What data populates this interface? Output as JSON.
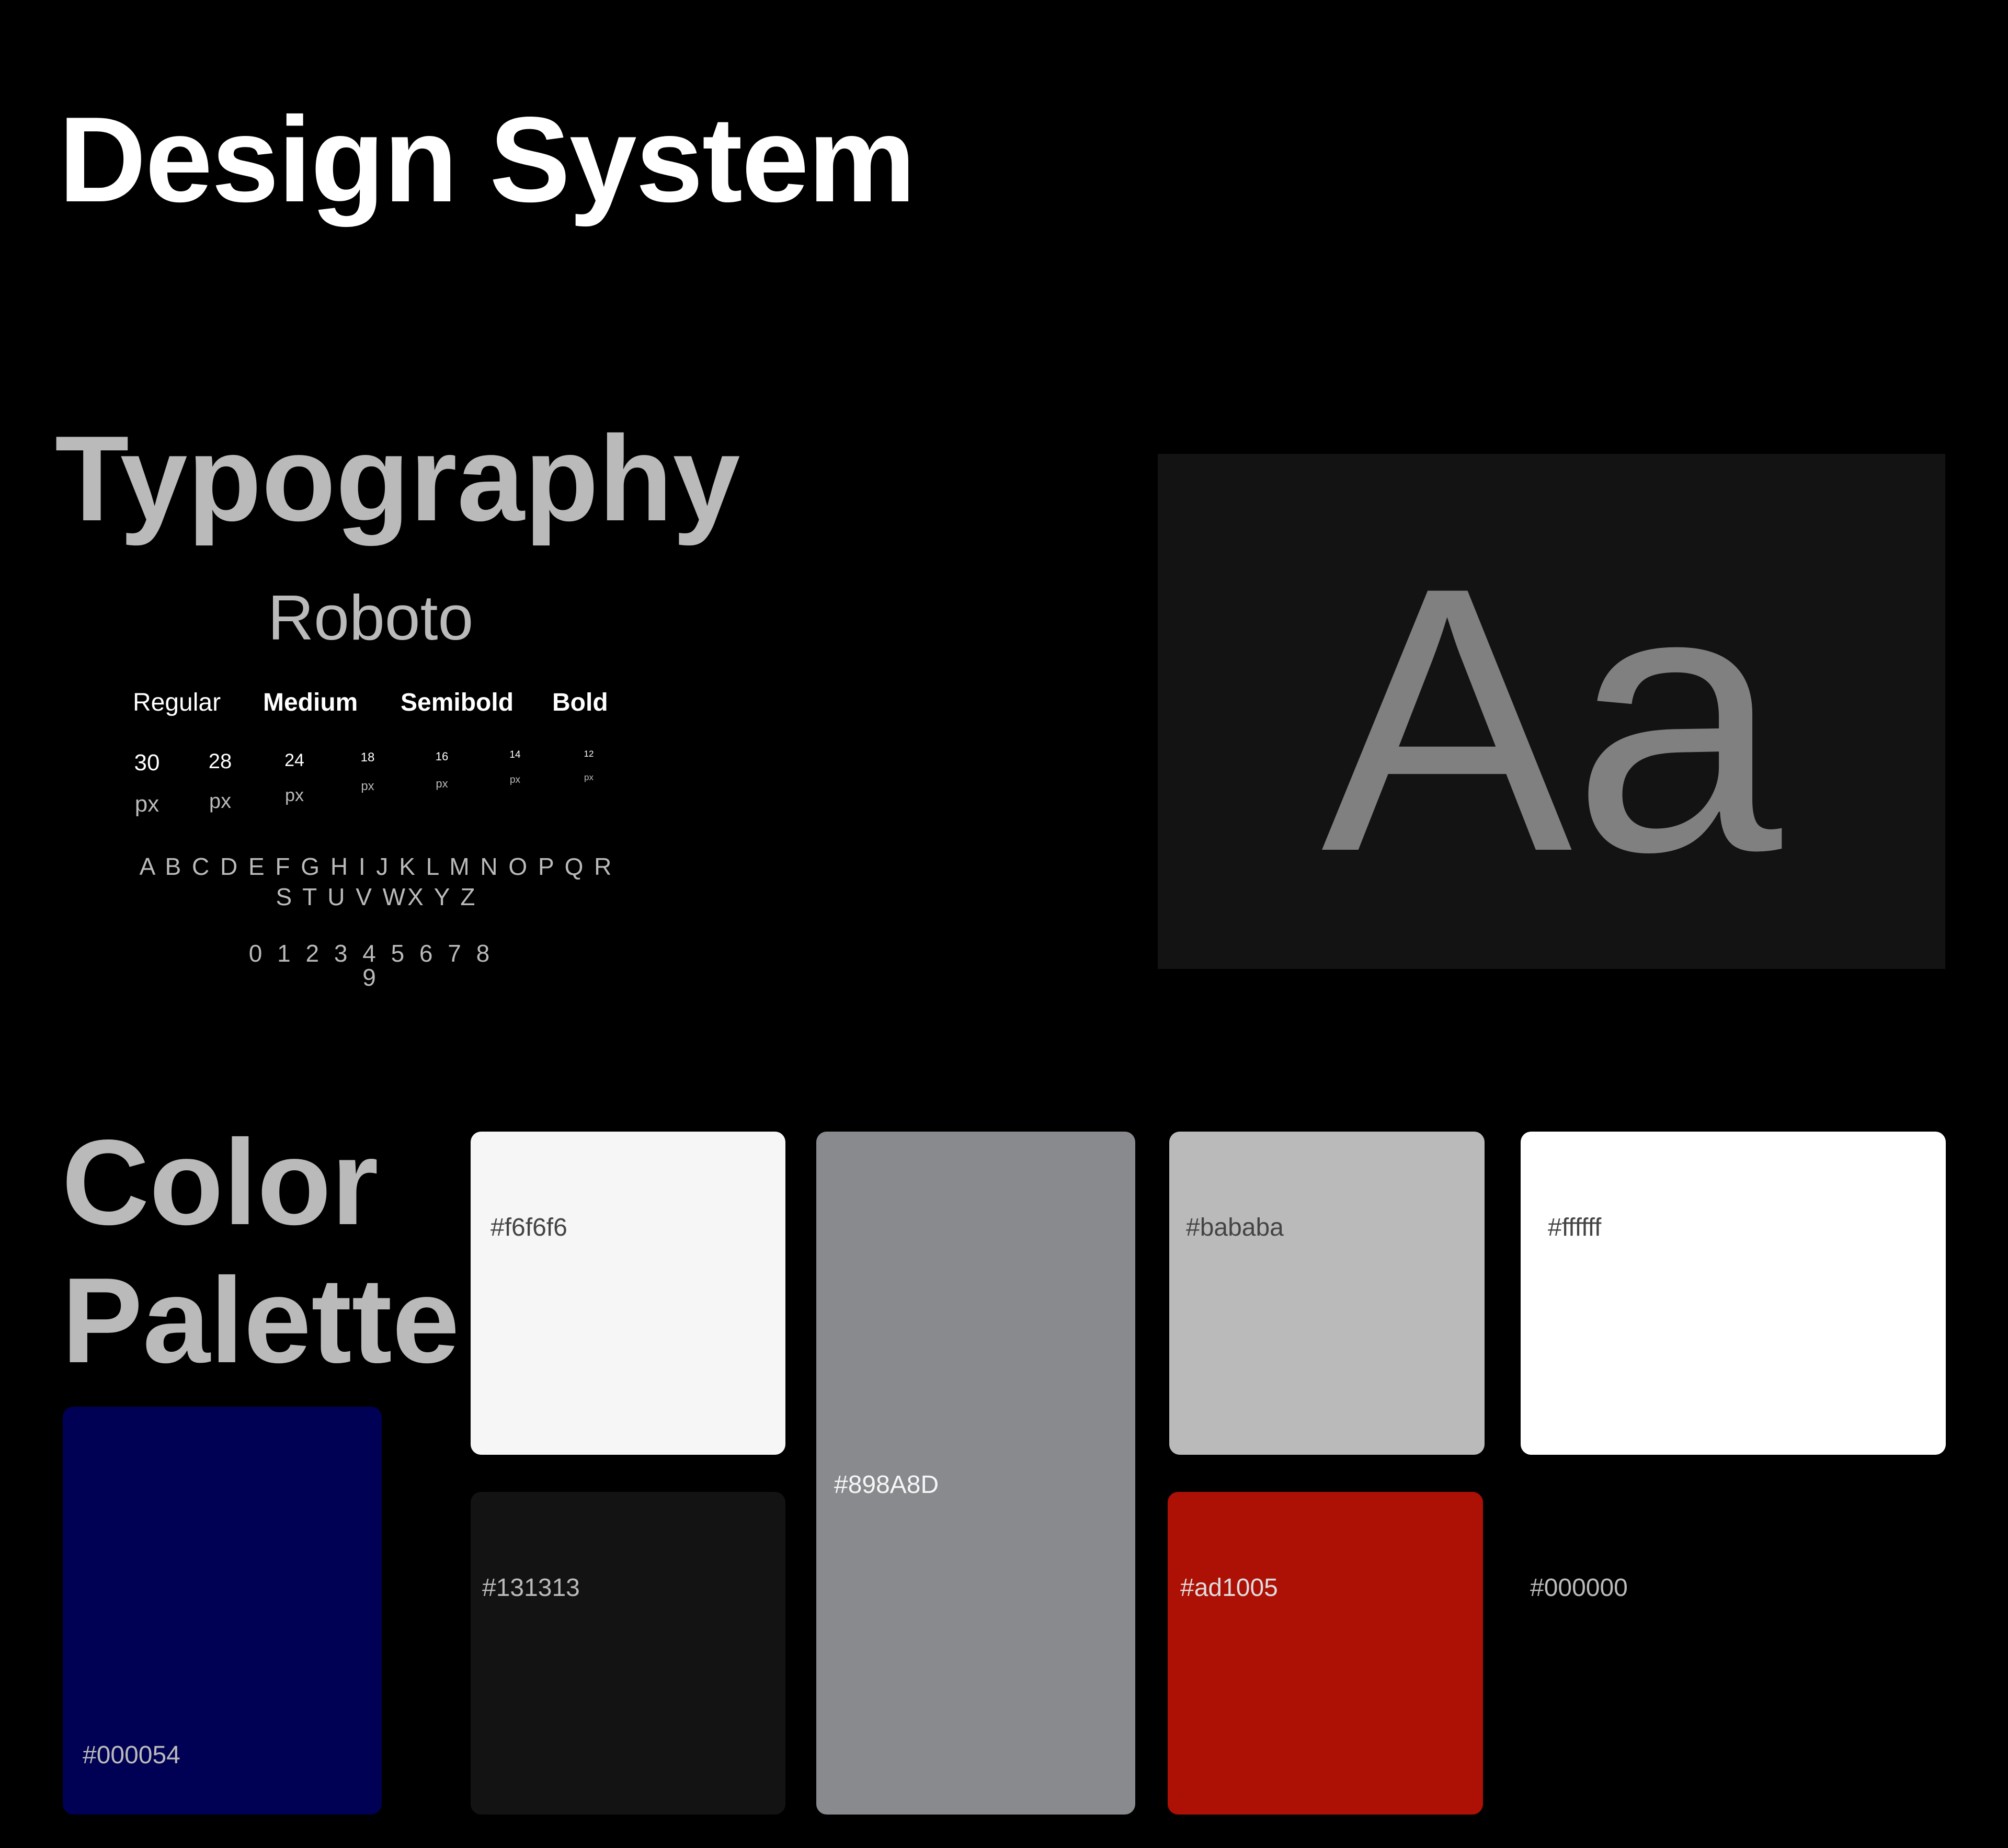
{
  "page": {
    "title": "Design System"
  },
  "typography": {
    "title": "Typography",
    "font_name": "Roboto",
    "weights": [
      "Regular",
      "Medium",
      "Semibold",
      "Bold"
    ],
    "sizes": [
      {
        "value": "30",
        "unit": "px"
      },
      {
        "value": "28",
        "unit": "px"
      },
      {
        "value": "24",
        "unit": "px"
      },
      {
        "value": "18",
        "unit": "px"
      },
      {
        "value": "16",
        "unit": "px"
      },
      {
        "value": "14",
        "unit": "px"
      },
      {
        "value": "12",
        "unit": "px"
      }
    ],
    "alphabet": "A B C D E F G H I J K L M N O P Q R S T U V WX Y Z",
    "digits": "0 1 2 3 4 5 6 7 8 9",
    "specimen": "Aa"
  },
  "palette": {
    "title_line1": "Color",
    "title_line2": "Palette",
    "colors": [
      {
        "label": "#000054",
        "color": "#000054"
      },
      {
        "label": "#f6f6f6",
        "color": "#f6f6f6"
      },
      {
        "label": "#131313",
        "color": "#131313"
      },
      {
        "label": "#898A8D",
        "color": "#898A8D"
      },
      {
        "label": "#bababa",
        "color": "#bababa"
      },
      {
        "label": "#ad1005",
        "color": "#ad1005"
      },
      {
        "label": "#ffffff",
        "color": "#ffffff"
      },
      {
        "label": "#000000",
        "color": "#000000"
      }
    ]
  }
}
